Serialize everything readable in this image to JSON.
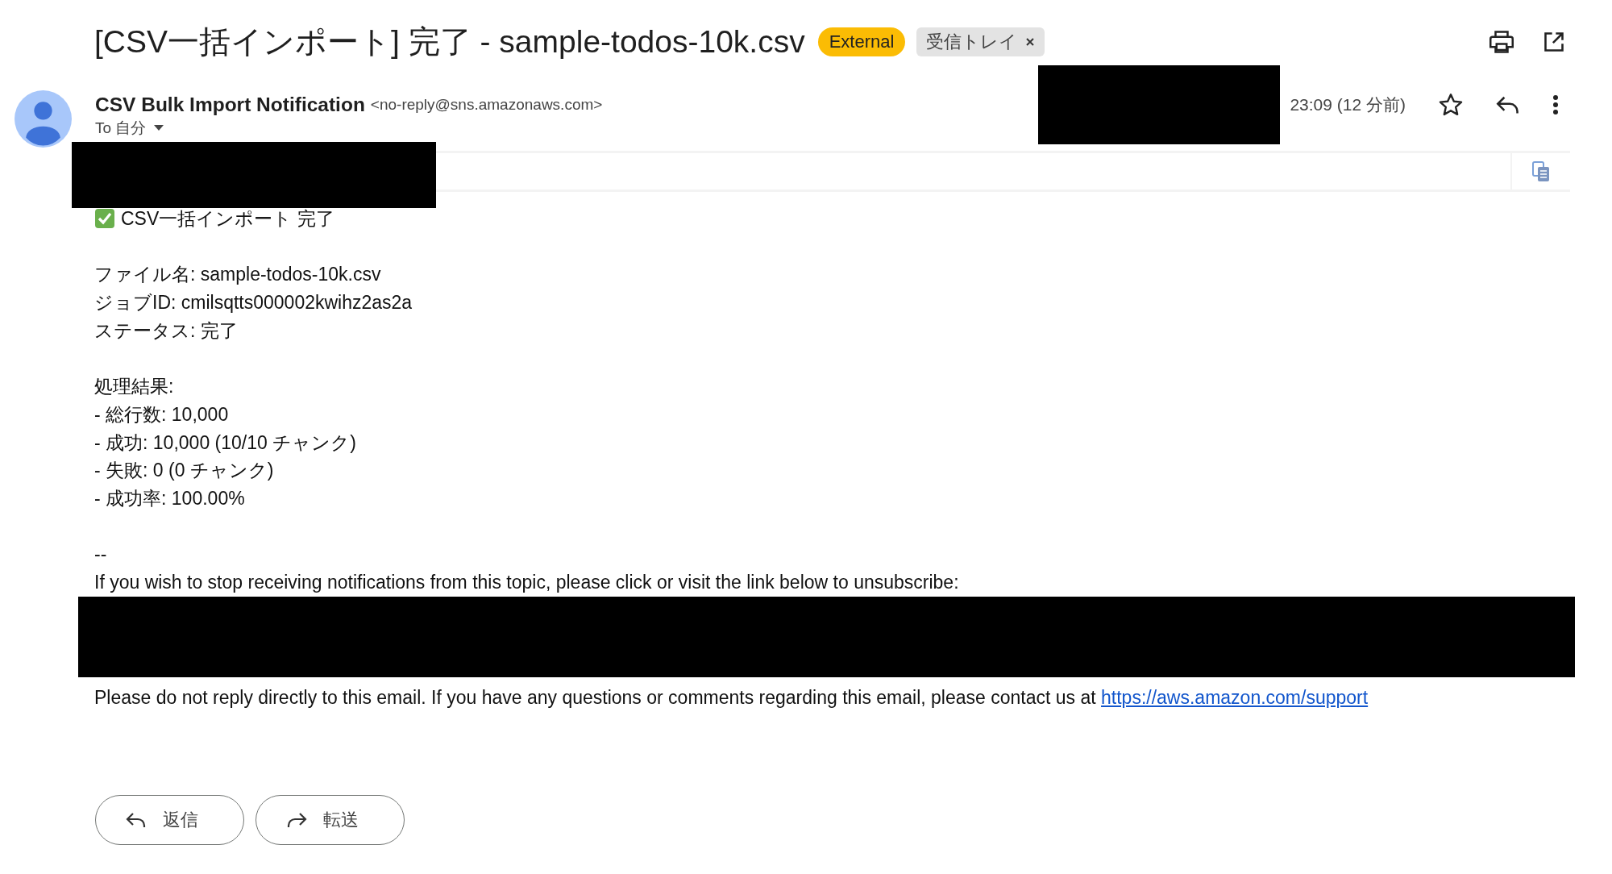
{
  "subject": "[CSV一括インポート] 完了 - sample-todos-10k.csv",
  "labels": [
    {
      "text": "External",
      "kind": "external",
      "removable": false
    },
    {
      "text": "受信トレイ",
      "kind": "folder",
      "removable": true
    }
  ],
  "sender": {
    "name": "CSV Bulk Import Notification",
    "address": "<no-reply@sns.amazonaws.com>",
    "recipient": "To 自分",
    "time": "23:09 (12 分前)",
    "starred": false
  },
  "body": {
    "heading": "CSV一括インポート 完了",
    "paragraphs": [
      [
        "ファイル名: sample-todos-10k.csv",
        "ジョブID: cmilsqtts000002kwihz2as2a",
        "ステータス: 完了"
      ],
      [
        "処理結果:",
        "- 総行数: 10,000",
        "- 成功: 10,000 (10/10 チャンク)",
        "- 失敗: 0 (0 チャンク)",
        "- 成功率: 100.00%"
      ],
      [
        "--",
        "If you wish to stop receiving notifications from this topic, please click or visit the link below to unsubscribe:"
      ]
    ],
    "footer": {
      "text": "Please do not reply directly to this email. If you have any questions or comments regarding this email, please contact us at",
      "link": "https://aws.amazon.com/support"
    }
  },
  "actions": [
    {
      "label": "返信",
      "kind": "reply"
    },
    {
      "label": "転送",
      "kind": "forward"
    }
  ]
}
